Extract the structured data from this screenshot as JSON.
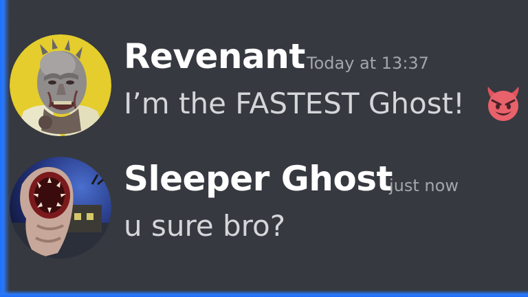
{
  "messages": [
    {
      "author": "Revenant",
      "timestamp": "Today at 13:37",
      "content": "I’m the FASTEST Ghost!",
      "avatar_icon": "revenant-avatar",
      "emoji_icon": "smiling-imp-icon"
    },
    {
      "author": "Sleeper Ghost",
      "timestamp": "just now",
      "content": "u sure bro?",
      "avatar_icon": "sleeper-ghost-avatar"
    }
  ],
  "colors": {
    "background": "#36393f",
    "username": "#ffffff",
    "message_text": "#d4d6d9",
    "timestamp": "#a3a6aa",
    "edge_glow": "#1d6fff",
    "avatar1_bg": "#e4cd2c"
  }
}
